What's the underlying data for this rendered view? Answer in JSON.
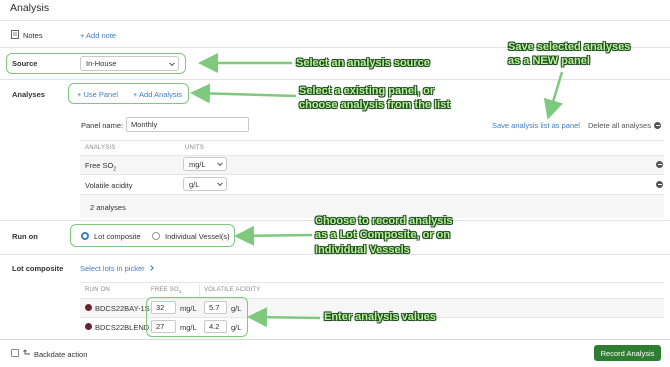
{
  "page": {
    "title": "Analysis"
  },
  "notes": {
    "label": "Notes",
    "add_note": "+ Add note"
  },
  "source": {
    "label": "Source",
    "value": "In-House"
  },
  "analyses": {
    "label": "Analyses",
    "use_panel": "+ Use Panel",
    "add_analysis": "+ Add Analysis",
    "panel_name_label": "Panel name:",
    "panel_name_value": "Monthly",
    "save_list": "Save analysis list as panel",
    "delete_all": "Delete all analyses",
    "col_analysis": "ANALYSIS",
    "col_units": "UNITS",
    "rows": [
      {
        "name": "Free SO",
        "sub": "2",
        "unit": "mg/L"
      },
      {
        "name": "Volatile acidity",
        "sub": "",
        "unit": "g/L"
      }
    ],
    "count": "2 analyses"
  },
  "run_on": {
    "label": "Run on",
    "option_lot": "Lot composite",
    "option_vessels": "Individual Vessel(s)",
    "selected": "Lot composite"
  },
  "lot_composite": {
    "label": "Lot composite",
    "select_lots": "Select lots in picker",
    "col_run_on": "RUN ON",
    "col_free_so2": "FREE SO",
    "col_free_so2_sub": "2",
    "col_va": "VOLATILE ACIDITY",
    "rows": [
      {
        "lot": "BDCS22BAY-1S",
        "so2": "32",
        "so2_unit": "mg/L",
        "va": "5.7",
        "va_unit": "g/L"
      },
      {
        "lot": "BDCS22BLEND",
        "so2": "27",
        "so2_unit": "mg/L",
        "va": "4.2",
        "va_unit": "g/L"
      }
    ]
  },
  "footer": {
    "backdate": "Backdate action",
    "record": "Record Analysis"
  },
  "callouts": {
    "source": "Select an analysis source",
    "save_panel_1": "Save selected analyses",
    "save_panel_2": "as a NEW panel",
    "panel_1": "Select a existing panel, or",
    "panel_2": "choose analysis from the list",
    "record_1": "Choose to record analysis",
    "record_2": "as a Lot Composite, or on",
    "record_3": "Individual Vessels",
    "values": "Enter analysis values"
  },
  "colors": {
    "accent": "#3d7fc4",
    "primary_button": "#2e7d32",
    "callout_box": "#7ec97e",
    "wine_dot": "#6b2332"
  }
}
